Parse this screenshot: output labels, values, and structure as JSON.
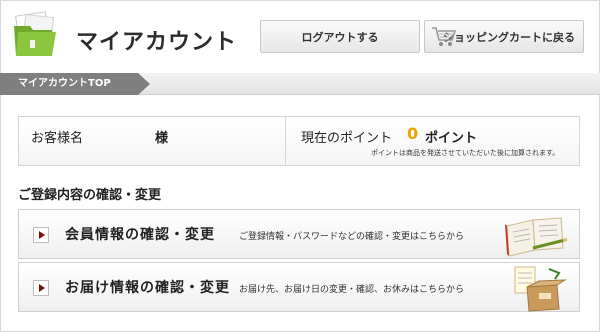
{
  "header": {
    "title": "マイアカウント",
    "logout_label": "ログアウトする",
    "cart_label": "ショッピングカートに戻る"
  },
  "breadcrumb": {
    "current": "マイアカウントTOP"
  },
  "account": {
    "customer_label": "お客様名",
    "honorific": "様",
    "points_label": "現在のポイント",
    "points_value": "0",
    "points_unit": "ポイント",
    "points_note": "ポイントは商品を発送させていただいた後に加算されます。"
  },
  "section": {
    "heading": "ご登録内容の確認・変更",
    "items": [
      {
        "title": "会員情報の確認・変更",
        "description": "ご登録情報・パスワードなどの確認・変更はこちらから",
        "illustration": "notebook-pen-icon"
      },
      {
        "title": "お届け情報の確認・変更",
        "description": "お届け先、お届け日の変更・確認、お休みはこちらから",
        "illustration": "delivery-box-icon"
      }
    ]
  },
  "colors": {
    "accent_points": "#f0a000",
    "breadcrumb_bg": "#7f7f7f",
    "folder_green": "#8cc63f",
    "arrow_red": "#8a0a0a"
  }
}
